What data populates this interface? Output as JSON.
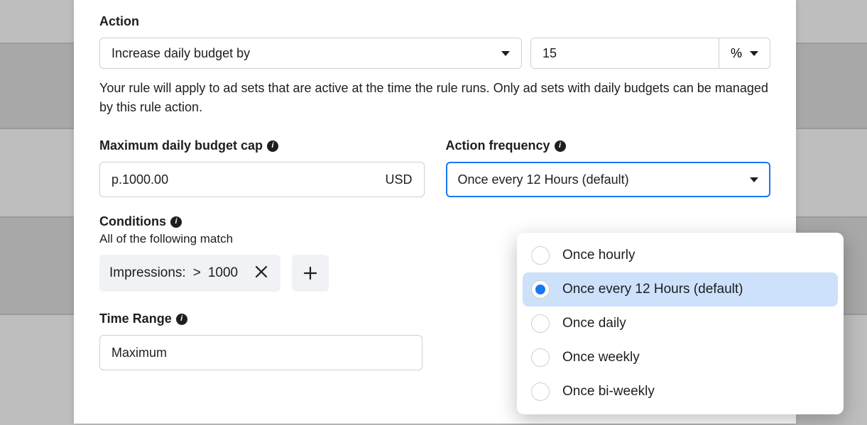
{
  "action": {
    "label": "Action",
    "select_value": "Increase daily budget by",
    "amount_value": "15",
    "unit_value": "%",
    "description": "Your rule will apply to ad sets that are active at the time the rule runs. Only ad sets with daily budgets can be managed by this rule action."
  },
  "budget_cap": {
    "label": "Maximum daily budget cap",
    "value": "р.1000.00",
    "currency": "USD"
  },
  "action_frequency": {
    "label": "Action frequency",
    "value": "Once every 12 Hours (default)",
    "options": [
      {
        "label": "Once hourly",
        "selected": false
      },
      {
        "label": "Once every 12 Hours (default)",
        "selected": true
      },
      {
        "label": "Once daily",
        "selected": false
      },
      {
        "label": "Once weekly",
        "selected": false
      },
      {
        "label": "Once bi-weekly",
        "selected": false
      }
    ]
  },
  "conditions": {
    "label": "Conditions",
    "sub_label": "All of the following match",
    "chip": {
      "metric": "Impressions:",
      "op": ">",
      "value": "1000"
    }
  },
  "time_range": {
    "label": "Time Range",
    "value": "Maximum"
  }
}
